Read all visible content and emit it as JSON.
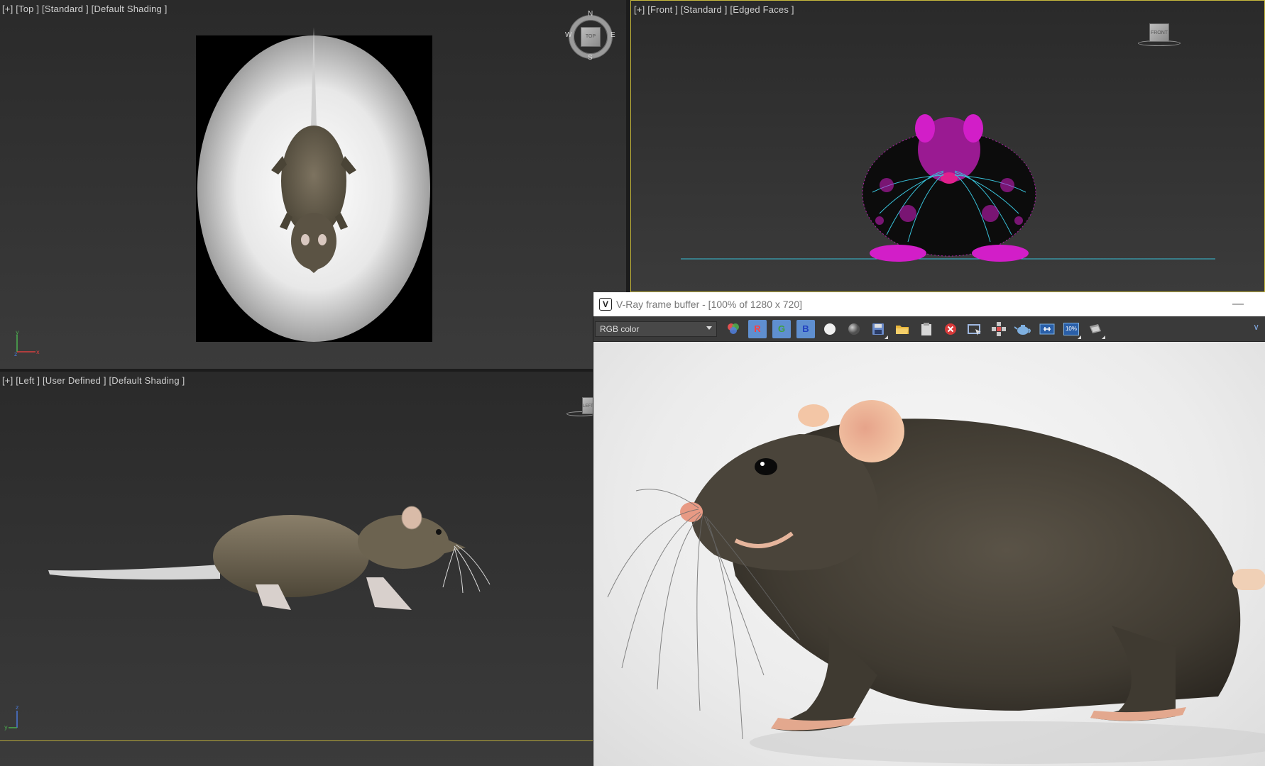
{
  "viewports": {
    "top": {
      "label": "[+] [Top ] [Standard ] [Default Shading ]"
    },
    "front": {
      "label": "[+] [Front ] [Standard ] [Edged Faces ]"
    },
    "left": {
      "label": "[+] [Left ] [User Defined ] [Default Shading ]"
    }
  },
  "viewcube": {
    "top_face": "TOP",
    "front_face": "FRONT",
    "left_face": "LEFT",
    "compass": {
      "n": "N",
      "s": "S",
      "e": "E",
      "w": "W"
    }
  },
  "axes": {
    "x": "x",
    "y": "y",
    "z": "z"
  },
  "vfb": {
    "title": "V-Ray frame buffer - [100% of 1280 x 720]",
    "logo": "V",
    "minimize": "—",
    "channel": "RGB color",
    "buttons": {
      "r": "R",
      "g": "G",
      "b": "B",
      "zoom_label": "10%"
    },
    "expand": "∨"
  },
  "colors": {
    "active_border": "#c7b93d",
    "channel_button": "#5f8fd0",
    "wire_magenta": "#d21ec8",
    "wire_cyan": "#38c0d8"
  }
}
